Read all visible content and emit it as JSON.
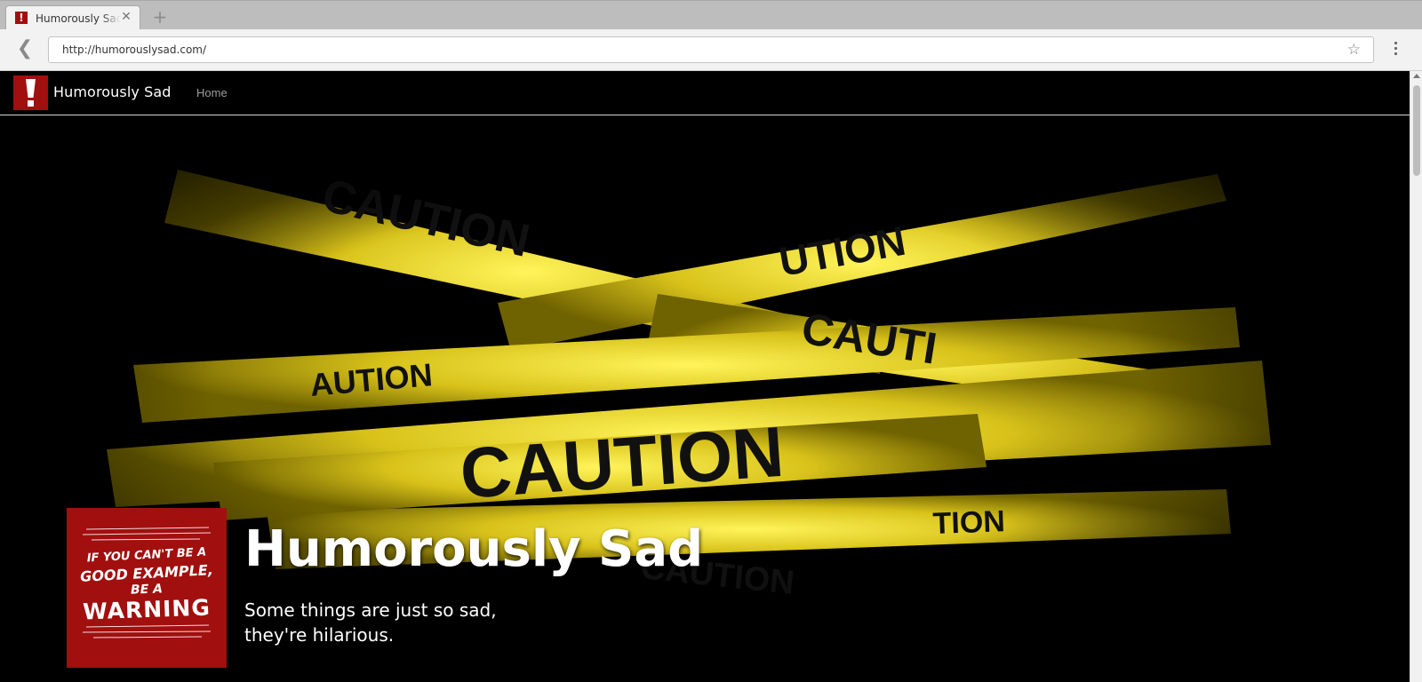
{
  "browser": {
    "tab": {
      "title": "Humorously Sad",
      "favicon_glyph": "!",
      "close_glyph": "✕"
    },
    "new_tab_glyph": "+",
    "back_glyph": "❮",
    "url": "http://humorouslysad.com/",
    "star_glyph": "☆"
  },
  "navbar": {
    "brand": "Humorously Sad",
    "links": [
      {
        "label": "Home"
      }
    ]
  },
  "hero": {
    "background": "caution-tape-image",
    "card": {
      "line1": "IF YOU CAN'T BE A",
      "line2": "GOOD EXAMPLE,",
      "line3": "BE A",
      "line4": "WARNING",
      "icon": "warning-poster"
    },
    "title": "Humorously Sad",
    "tagline_line1": "Some things are just so sad,",
    "tagline_line2": "they're hilarious."
  },
  "colors": {
    "brand_red": "#a10f0f",
    "tape_yellow": "#e6d11c",
    "page_bg": "#000000"
  }
}
